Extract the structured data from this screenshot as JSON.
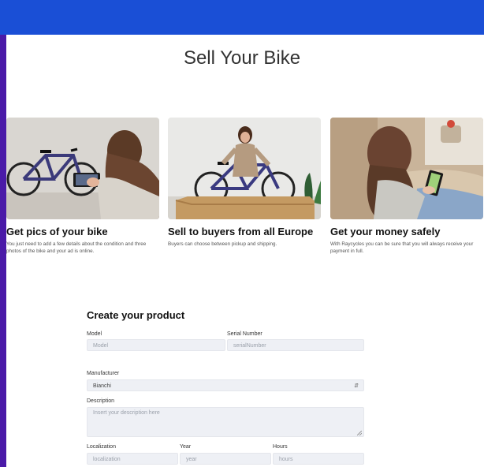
{
  "header": {
    "title": "Sell Your Bike"
  },
  "cards": [
    {
      "title": "Get pics of your bike",
      "text": "You just need to add a few details about the condition and three photos of the bike and your ad is online."
    },
    {
      "title": "Sell to buyers from all Europe",
      "text": "Buyers can choose between pickup and shipping."
    },
    {
      "title": "Get your money safely",
      "text": "With Raycycles you can be sure that you will always receive your payment in full."
    }
  ],
  "form": {
    "title": "Create your product",
    "model": {
      "label": "Model",
      "placeholder": "Model"
    },
    "serial": {
      "label": "Serial Number",
      "placeholder": "serialNumber"
    },
    "manufacturer": {
      "label": "Manufacturer",
      "value": "Bianchi"
    },
    "description": {
      "label": "Description",
      "placeholder": "Insert your description here"
    },
    "localization": {
      "label": "Localization",
      "placeholder": "localization"
    },
    "year": {
      "label": "Year",
      "placeholder": "year"
    },
    "hours": {
      "label": "Hours",
      "placeholder": "hours"
    }
  },
  "colors": {
    "top_bar": "#1a4fd6",
    "left_bar": "#4a1aa8",
    "field_bg": "#eef0f5"
  }
}
